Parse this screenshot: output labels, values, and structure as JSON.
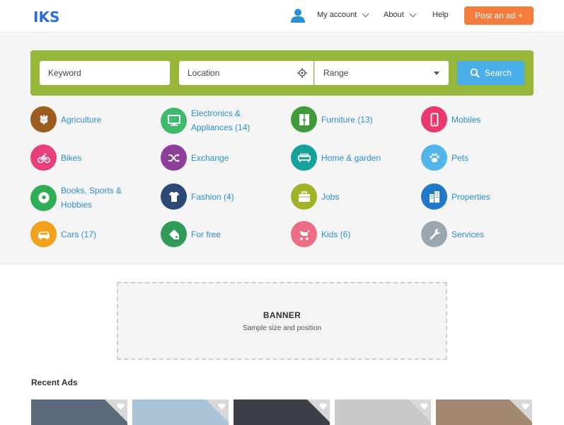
{
  "header": {
    "logo_text": "IKS",
    "nav": [
      {
        "label": "My account"
      },
      {
        "label": "About"
      },
      {
        "label": "Help"
      }
    ],
    "post_button": "Post an ad +"
  },
  "search": {
    "keyword_placeholder": "Keyword",
    "location_placeholder": "Location",
    "range_label": "Range",
    "button_label": "Search",
    "bar_color": "#97b73a",
    "button_color": "#4aaee8"
  },
  "categories": [
    {
      "label": "Agriculture",
      "icon": "wheat-icon",
      "color": "#9c5b1f"
    },
    {
      "label": "Electronics & Appliances (14)",
      "icon": "monitor-icon",
      "color": "#3fb96b"
    },
    {
      "label": "Furniture (13)",
      "icon": "cabinet-icon",
      "color": "#3f9b3a"
    },
    {
      "label": "Mobiles",
      "icon": "phone-icon",
      "color": "#e8396c"
    },
    {
      "label": "Bikes",
      "icon": "bicycle-icon",
      "color": "#e83f7e"
    },
    {
      "label": "Exchange",
      "icon": "shuffle-icon",
      "color": "#8d3f9a"
    },
    {
      "label": "Home & garden",
      "icon": "sofa-icon",
      "color": "#16a19a"
    },
    {
      "label": "Pets",
      "icon": "paw-icon",
      "color": "#53b6ea"
    },
    {
      "label": "Books, Sports & Hobbies",
      "icon": "soccer-ball-icon",
      "color": "#2fae57"
    },
    {
      "label": "Fashion (4)",
      "icon": "tshirt-icon",
      "color": "#2c4a78"
    },
    {
      "label": "Jobs",
      "icon": "briefcase-icon",
      "color": "#a2b329"
    },
    {
      "label": "Properties",
      "icon": "building-icon",
      "color": "#1f78c8"
    },
    {
      "label": "Cars (17)",
      "icon": "car-icon",
      "color": "#f3a11a"
    },
    {
      "label": "For free",
      "icon": "tag-icon",
      "color": "#2f9b57"
    },
    {
      "label": "Kids (6)",
      "icon": "stroller-icon",
      "color": "#ec6d84"
    },
    {
      "label": "Services",
      "icon": "wrench-icon",
      "color": "#9aa7b1"
    }
  ],
  "banner": {
    "title": "BANNER",
    "subtitle": "Sample size and position"
  },
  "recent": {
    "title": "Recent Ads",
    "ads": [
      {
        "thumb_color": "#5a6a7a"
      },
      {
        "thumb_color": "#aac3d6"
      },
      {
        "thumb_color": "#3c3f45"
      },
      {
        "thumb_color": "#c9c9c9"
      },
      {
        "thumb_color": "#a28870"
      }
    ]
  },
  "colors": {
    "accent_orange": "#f47c3c",
    "link_blue": "#2b8fd1"
  }
}
